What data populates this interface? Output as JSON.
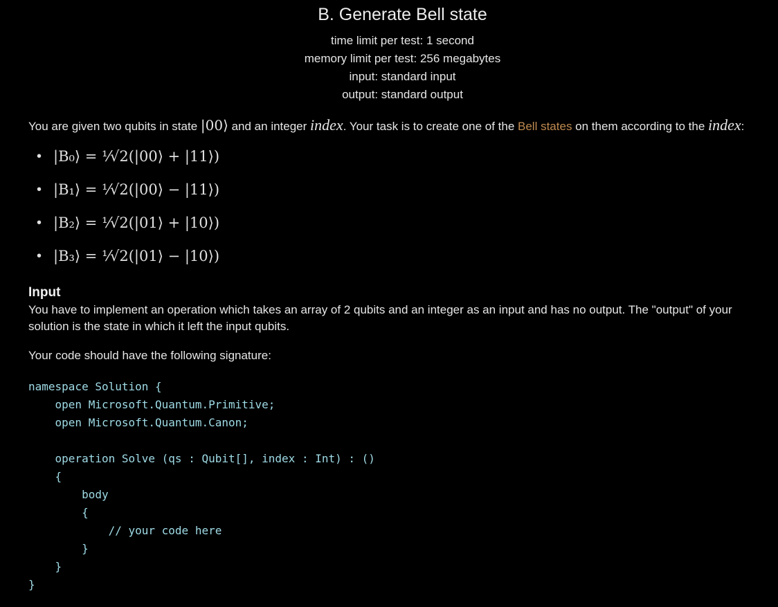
{
  "problem": {
    "title": "B. Generate Bell state",
    "time_limit": "time limit per test: 1 second",
    "memory_limit": "memory limit per test: 256 megabytes",
    "input": "input: standard input",
    "output": "output: standard output"
  },
  "statement": {
    "intro_1": "You are given two qubits in state ",
    "intro_ket": "|00⟩",
    "intro_2": " and an integer ",
    "index_var": "index",
    "intro_3": ". Your task is to create one of the ",
    "bell_link": "Bell states",
    "intro_4": " on them according to the ",
    "intro_5": ":",
    "bell_states": [
      "|B₀⟩ = ¹⁄√2(|00⟩ + |11⟩)",
      "|B₁⟩ = ¹⁄√2(|00⟩ − |11⟩)",
      "|B₂⟩ = ¹⁄√2(|01⟩ + |10⟩)",
      "|B₃⟩ = ¹⁄√2(|01⟩ − |10⟩)"
    ]
  },
  "input_section": {
    "title": "Input",
    "text": "You have to implement an operation which takes an array of 2 qubits and an integer as an input and has no output. The \"output\" of your solution is the state in which it left the input qubits.",
    "signature_text": "Your code should have the following signature:",
    "code": "namespace Solution {\n    open Microsoft.Quantum.Primitive;\n    open Microsoft.Quantum.Canon;\n\n    operation Solve (qs : Qubit[], index : Int) : ()\n    {\n        body\n        {\n            // your code here\n        }\n    }\n}"
  },
  "colors": {
    "background": "#000000",
    "text": "#e6e6e6",
    "link": "#c08a50",
    "code": "#9fdbe6"
  }
}
